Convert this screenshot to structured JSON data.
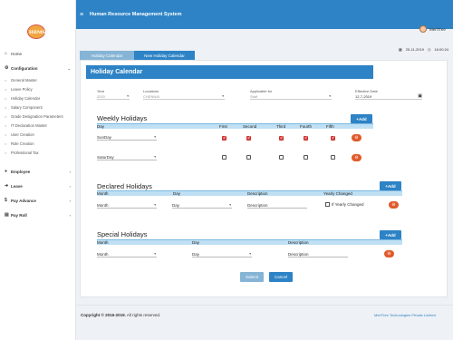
{
  "header": {
    "logo_text": "HRMS",
    "menu_icon": "hamburger-icon",
    "title": "Human Resource Management System",
    "user_name": "MeriTree"
  },
  "date_area": {
    "date": "25-11-2019",
    "time": "16:00:24"
  },
  "sidebar": {
    "items": [
      {
        "label": "Home",
        "icon": "home-icon"
      },
      {
        "label": "Configuration",
        "icon": "cog-icon"
      },
      {
        "label": "Employee",
        "icon": "users-icon"
      },
      {
        "label": "Leave",
        "icon": "leave-icon"
      },
      {
        "label": "Pay Advance",
        "icon": "money-icon"
      },
      {
        "label": "Pay Roll",
        "icon": "payroll-icon"
      }
    ],
    "sub_items": [
      "General Master",
      "Leave Policy",
      "Holiday Calendar",
      "Salary Component",
      "Grade Designation Parameters",
      "IT Declaration Master",
      "User Creation",
      "Role Creation",
      "Professional Tax"
    ]
  },
  "tabs": [
    "Holiday Calendar",
    "New Holiday Calendar"
  ],
  "panel": {
    "title": "Holiday Calendar",
    "fields": {
      "year_label": "Year",
      "year_value": "2020",
      "locations_label": "Locations",
      "locations_value": "CHENNAI",
      "applicable_label": "Applicable for",
      "applicable_value": "Staff",
      "effective_label": "Effective Date",
      "effective_value": "12-7-2019"
    },
    "weekly": {
      "title": "Weekly Holidays",
      "add_label": "Add",
      "headers": [
        "Day",
        "First",
        "Second",
        "Third",
        "Fourth",
        "Fifth"
      ],
      "rows": [
        {
          "day": "SunDay",
          "checks": [
            true,
            true,
            true,
            true,
            true
          ]
        },
        {
          "day": "SaturDay",
          "checks": [
            false,
            false,
            false,
            false,
            false
          ]
        }
      ]
    },
    "declared": {
      "title": "Declared Holidays",
      "add_label": "Add",
      "headers": [
        "Month",
        "Day",
        "Description",
        "Yearly Changed"
      ],
      "row": {
        "month": "Month",
        "day": "Day",
        "description": "Description",
        "yearly": "If Yearly Changed"
      }
    },
    "special": {
      "title": "Special Holidays",
      "add_label": "Add",
      "headers": [
        "Month",
        "Day",
        "Description"
      ],
      "row": {
        "month": "Month",
        "day": "Day",
        "description": "Description"
      }
    },
    "submit_label": "Submit",
    "cancel_label": "Cancel"
  },
  "footer": {
    "copyright_bold": "Copyright © 2016-2019.",
    "copyright_rest": " All rights reserved.",
    "company": "MeriTree Technologies Private Limited"
  }
}
